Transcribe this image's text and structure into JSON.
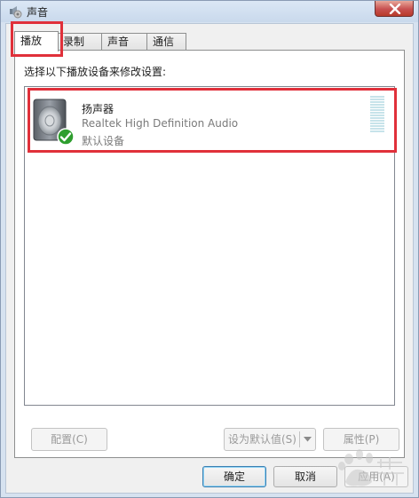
{
  "window": {
    "title": "声音"
  },
  "tabs": [
    {
      "label": "播放",
      "active": true
    },
    {
      "label": "录制",
      "active": false
    },
    {
      "label": "声音",
      "active": false
    },
    {
      "label": "通信",
      "active": false
    }
  ],
  "playback": {
    "instruction": "选择以下播放设备来修改设置:",
    "devices": [
      {
        "name": "扬声器",
        "description": "Realtek High Definition Audio",
        "status": "默认设备",
        "icon": "speaker-icon",
        "badge": "default-check-icon"
      }
    ]
  },
  "page_buttons": {
    "configure": "配置(C)",
    "set_default": "设为默认值(S)",
    "properties": "属性(P)"
  },
  "dialog_buttons": {
    "ok": "确定",
    "cancel": "取消",
    "apply": "应用(A)"
  },
  "colors": {
    "highlight": "#e0303a",
    "check": "#2e9e2e",
    "level_meter": "#c7e3ea"
  }
}
